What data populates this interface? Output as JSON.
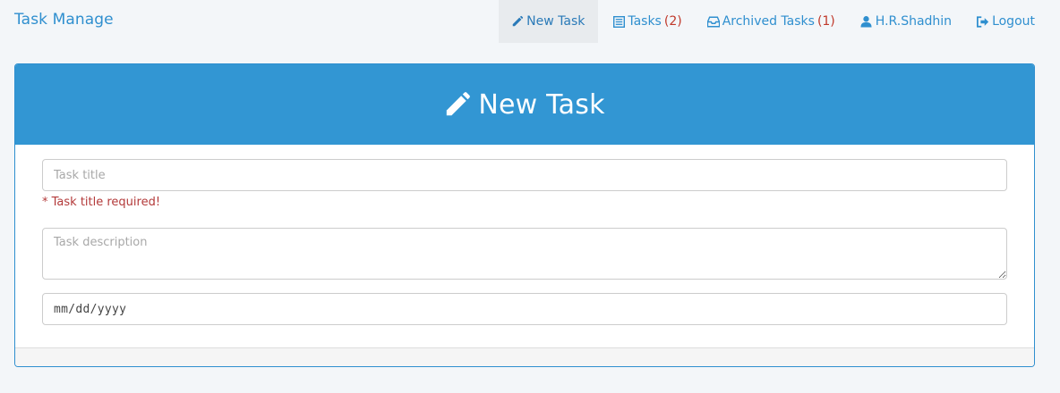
{
  "brand": "Task Manage",
  "nav": {
    "new_task": "New Task",
    "tasks": "Tasks",
    "tasks_count": "(2)",
    "archived": "Archived Tasks",
    "archived_count": "(1)",
    "user": "H.R.Shadhin",
    "logout": "Logout"
  },
  "panel": {
    "title": "New Task",
    "title_placeholder": "Task title",
    "error": "* Task title required!",
    "description_placeholder": "Task description",
    "date_format": "mm/dd/yyyy"
  },
  "colors": {
    "accent": "#3296d3",
    "link": "#2f8fcf",
    "error": "#b33a3a"
  },
  "icons": {
    "new_task": "pencil-icon",
    "tasks": "list-icon",
    "archived": "inbox-icon",
    "user": "user-icon",
    "logout": "logout-icon",
    "heading": "pencil-icon"
  }
}
